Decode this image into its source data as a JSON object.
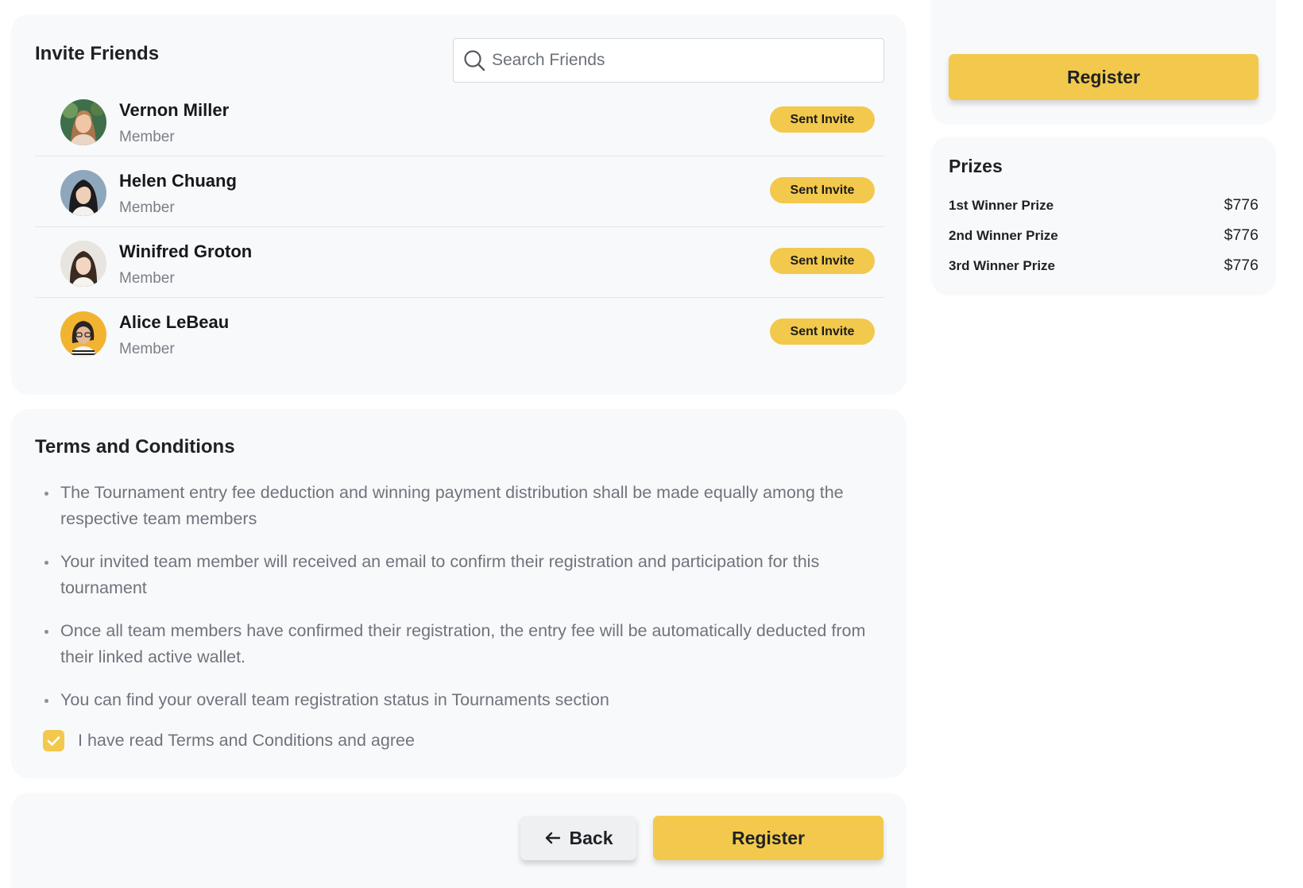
{
  "invite": {
    "title": "Invite Friends",
    "search_placeholder": "Search Friends",
    "friends": [
      {
        "name": "Vernon Miller",
        "role": "Member",
        "action": "Sent Invite"
      },
      {
        "name": "Helen Chuang",
        "role": "Member",
        "action": "Sent Invite"
      },
      {
        "name": "Winifred Groton",
        "role": "Member",
        "action": "Sent Invite"
      },
      {
        "name": "Alice LeBeau",
        "role": "Member",
        "action": "Sent Invite"
      }
    ]
  },
  "terms": {
    "title": "Terms and Conditions",
    "items": [
      "The Tournament entry fee deduction and winning payment distribution shall be made equally among the respective team members",
      "Your invited team member will received an email to confirm their registration and participation for this tournament",
      "Once all team members have confirmed their registration, the entry fee will be automatically deducted from their linked active wallet.",
      "You can find your overall team registration status in Tournaments section"
    ],
    "agree_label": "I have read Terms and Conditions and agree",
    "agree_checked": true
  },
  "actions": {
    "back_label": "Back",
    "register_label": "Register"
  },
  "sidebar": {
    "register_label": "Register",
    "prizes_title": "Prizes",
    "prizes": [
      {
        "label": "1st Winner Prize",
        "value": "$776"
      },
      {
        "label": "2nd Winner Prize",
        "value": "$776"
      },
      {
        "label": "3rd Winner Prize",
        "value": "$776"
      }
    ]
  },
  "colors": {
    "accent": "#f2c94c",
    "card_bg": "#f8f9fb",
    "muted_text": "#6f747c"
  },
  "icons": {
    "search": "search-icon",
    "back": "arrow-left-icon",
    "check": "check-icon",
    "avatar": "avatar"
  }
}
